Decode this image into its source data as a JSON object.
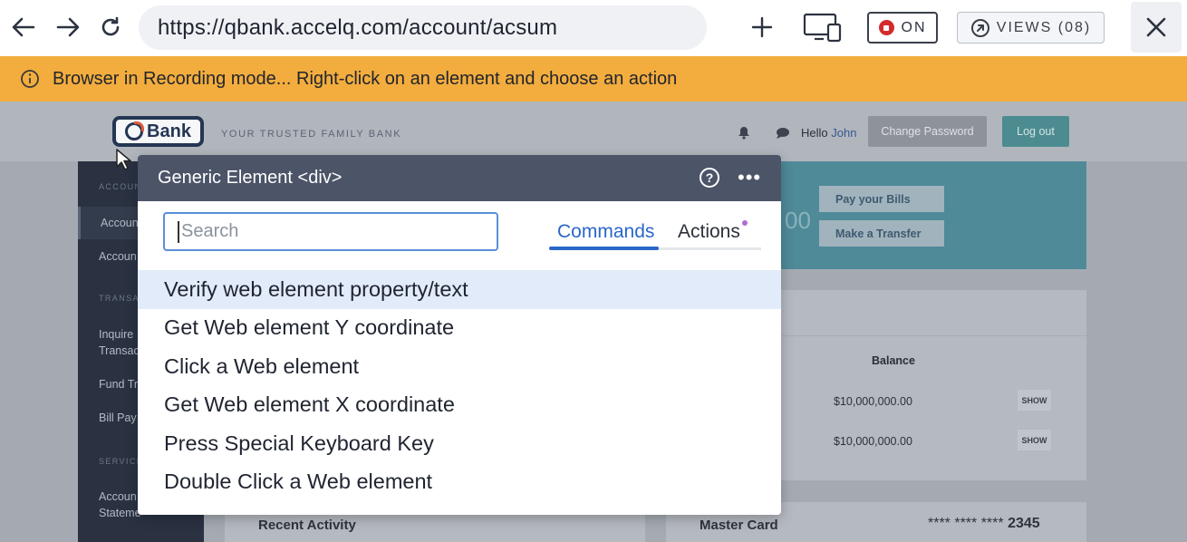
{
  "browser": {
    "url": "https://qbank.accelq.com/account/acsum",
    "record_label": "ON",
    "views_label": "VIEWS (08)"
  },
  "banner": {
    "text": "Browser in Recording mode... Right-click on an element and choose an action"
  },
  "site": {
    "logo_text": "Bank",
    "tagline": "YOUR TRUSTED FAMILY BANK",
    "hello": "Hello",
    "user": "John",
    "change_password": "Change Password",
    "logout": "Log out"
  },
  "sidebar": {
    "sections": [
      "ACCOUN",
      "TRANSA",
      "SERVICE"
    ],
    "items": [
      "Accoun",
      "Accoun",
      "Inquire",
      "Transac",
      "Fund Tr",
      "Bill Pay",
      "Accoun",
      "Stateme"
    ]
  },
  "hero": {
    "pay_bills": "Pay your Bills",
    "make_transfer": "Make a Transfer",
    "partial_amount": "00"
  },
  "accounts": {
    "balance_header": "Balance",
    "balances": [
      "$10,000,000.00",
      "$10,000,000.00"
    ],
    "show_label": "SHOW"
  },
  "cards": {
    "recent_activity": "Recent Activity",
    "master_card": "Master Card",
    "card_mask": "**** **** ****",
    "card_last4": "2345"
  },
  "popup": {
    "title": "Generic Element <div>",
    "search_placeholder": "Search",
    "tabs": [
      "Commands",
      "Actions"
    ],
    "commands": [
      "Verify web element property/text",
      "Get Web element Y coordinate",
      "Click a Web element",
      "Get Web element X coordinate",
      "Press Special Keyboard Key",
      "Double Click a Web element"
    ]
  },
  "colors": {
    "banner": "#f3ad3e",
    "popup_header": "#4c5468",
    "accent": "#2a67c8",
    "selected_row": "#e2ebfa"
  }
}
